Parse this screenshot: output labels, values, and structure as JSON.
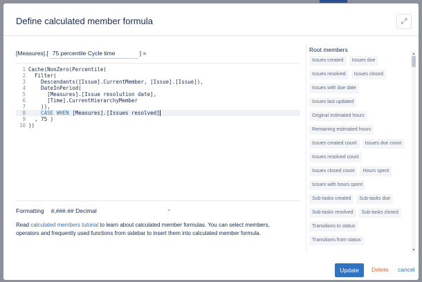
{
  "dialog": {
    "title": "Define calculated member formula",
    "expand_icon": "expand-arrows-icon"
  },
  "formula": {
    "prefix": "[Measures].[",
    "name_value": "75 percentile Cycle time",
    "suffix": "] ="
  },
  "editor": {
    "active_line": 8,
    "lines": [
      {
        "num": "1",
        "text": "Cache(NonZero(Percentile("
      },
      {
        "num": "2",
        "text": "  Filter("
      },
      {
        "num": "3",
        "text": "    Descendants([Issue].CurrentMember, [Issue].[Issue]),"
      },
      {
        "num": "4",
        "text": "    DateInPeriod("
      },
      {
        "num": "5",
        "text": "      [Measures].[Issue resolution date],"
      },
      {
        "num": "6",
        "text": "      [Time].CurrentHierarchyMember"
      },
      {
        "num": "7",
        "text": "    )),"
      },
      {
        "num": "8",
        "kw": "    CASE WHEN ",
        "text": "[Measures].[Issues resolved]"
      },
      {
        "num": "9",
        "text": "  , 75 )"
      },
      {
        "num": "10",
        "text": "))"
      }
    ]
  },
  "formatting": {
    "label": "Formatting",
    "value": "#,###.## Decimal",
    "chevron_icon": "chevron-down-icon"
  },
  "help": {
    "before": "Read ",
    "link": "calculated members tutorial",
    "after": " to learn about calculated member formulas. You can select members, operators and frequently used functions from sidebar to insert them into calculated member formula."
  },
  "sidebar": {
    "title": "Root members",
    "items": [
      "Issues created",
      "Issues due",
      "Issues resolved",
      "Issues closed",
      "Issues with due date",
      "Issues last updated",
      "Original estimated hours",
      "Remaining estimated hours",
      "Issues created count",
      "Issues due count",
      "Issues resolved count",
      "Issues closed count",
      "Hours spent",
      "Issues with hours spent",
      "Sub-tasks created",
      "Sub-tasks due",
      "Sub-tasks resolved",
      "Sub-tasks closed",
      "Transitions to status",
      "Transitions from status"
    ]
  },
  "footer": {
    "update_label": "Update",
    "delete_label": "Delete",
    "cancel_label": "cancel"
  },
  "colors": {
    "primary": "#2f74c0",
    "delete": "#d86d3c",
    "link": "#3572b0"
  }
}
